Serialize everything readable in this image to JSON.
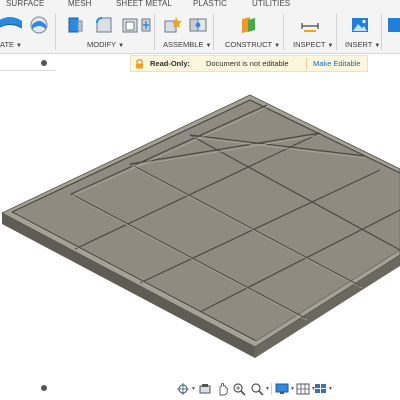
{
  "tabs": [
    "SURFACE",
    "MESH",
    "SHEET METAL",
    "PLASTIC",
    "UTILITIES"
  ],
  "groups": {
    "create_partial": "ATE",
    "modify": "MODIFY",
    "assemble": "ASSEMBLE",
    "construct": "CONSTRUCT",
    "inspect": "INSPECT",
    "insert": "INSERT"
  },
  "banner": {
    "title": "Read-Only:",
    "message": "Document is not editable",
    "action": "Make Editable"
  },
  "colors": {
    "accent_blue": "#1f7fd6",
    "tray_top": "#8e8a80",
    "tray_side": "#5e5b55",
    "banner_bg": "#fdf6dc",
    "link": "#0a6cc9"
  },
  "icons": {
    "create_tools": [
      "create-form-icon",
      "sweep-surface-icon"
    ],
    "modify_tools": [
      "press-pull-icon",
      "fillet-icon",
      "shell-icon",
      "move-icon"
    ],
    "assemble_tools": [
      "new-component-icon",
      "joint-icon"
    ],
    "construct_tools": [
      "offset-plane-icon"
    ],
    "inspect_tools": [
      "measure-icon"
    ],
    "insert_tools": [
      "insert-image-icon"
    ],
    "banner": "lock-icon",
    "nav": [
      "orbit-icon",
      "pan-icon",
      "look-at-icon",
      "zoom-icon",
      "fit-icon",
      "display-settings-icon",
      "grid-icon",
      "viewports-icon"
    ]
  }
}
